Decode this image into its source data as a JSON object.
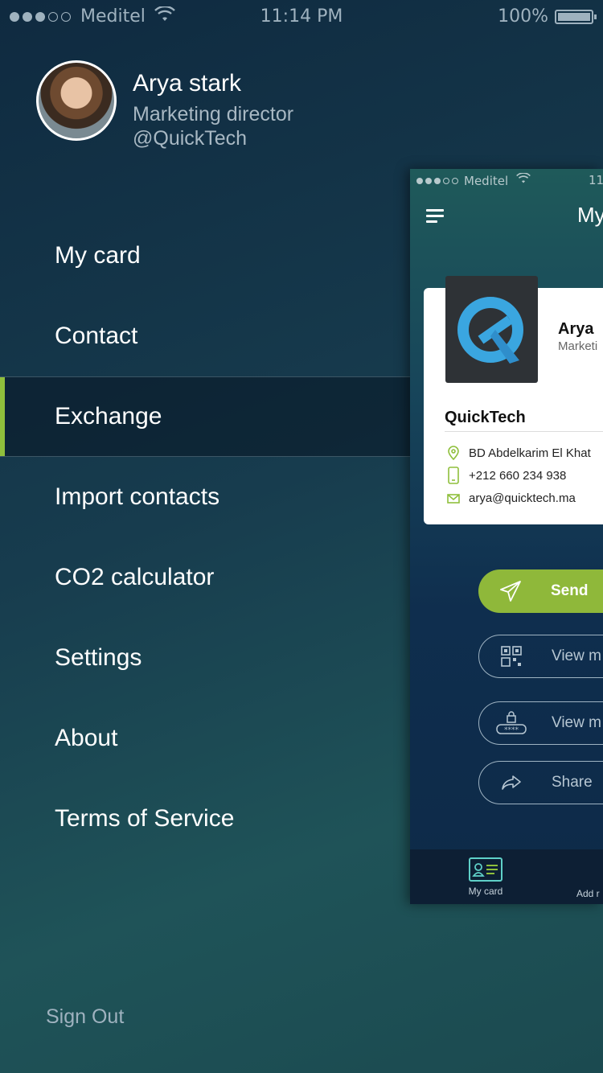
{
  "status_bar": {
    "carrier": "Meditel",
    "time": "11:14 PM",
    "battery": "100%"
  },
  "profile": {
    "name": "Arya stark",
    "role": "Marketing director",
    "company": "@QuickTech"
  },
  "menu": {
    "items": [
      {
        "label": "My card"
      },
      {
        "label": "Contact"
      },
      {
        "label": "Exchange"
      },
      {
        "label": "Import contacts"
      },
      {
        "label": "CO2 calculator"
      },
      {
        "label": "Settings"
      },
      {
        "label": "About"
      },
      {
        "label": "Terms of Service"
      }
    ],
    "active_index": 2
  },
  "sign_out": "Sign Out",
  "preview": {
    "status": {
      "carrier": "Meditel",
      "time": "11"
    },
    "title": "My",
    "card": {
      "name": "Arya",
      "role": "Marketi",
      "company": "QuickTech",
      "address": "BD Abdelkarim El Khat",
      "phone": "+212 660 234 938",
      "email": "arya@quicktech.ma"
    },
    "buttons": {
      "send": "Send",
      "view_qr": "View m",
      "view_pin": "View m",
      "share": "Share"
    },
    "tabs": {
      "my_card": "My card",
      "add": "Add r"
    }
  },
  "colors": {
    "accent": "#8fbf3c",
    "menu_active_bg": "#0a1a2b",
    "logo_blue": "#3aa6e0"
  }
}
